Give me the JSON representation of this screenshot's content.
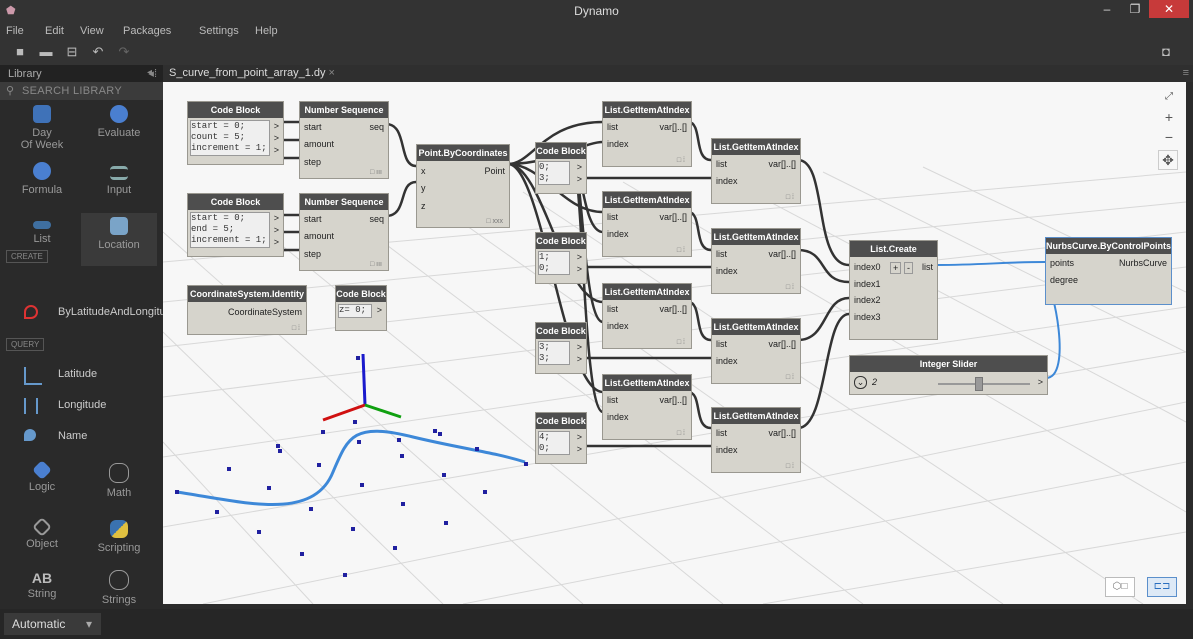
{
  "window": {
    "title": "Dynamo",
    "minimize": "–",
    "maximize": "❐",
    "close": "✕"
  },
  "menu": [
    "File",
    "Edit",
    "View",
    "Packages",
    "Settings",
    "Help"
  ],
  "library": {
    "title": "Library",
    "search_placeholder": "SEARCH LIBRARY",
    "categories_top": [
      {
        "label": "Day\nOf Week",
        "icon": "calendar-icon"
      },
      {
        "label": "Evaluate",
        "icon": "evaluate-icon"
      },
      {
        "label": "Formula",
        "icon": "formula-icon"
      },
      {
        "label": "Input",
        "icon": "input-icon"
      },
      {
        "label": "List",
        "icon": "list-icon"
      },
      {
        "label": "Location",
        "icon": "location-icon"
      }
    ],
    "create_label": "CREATE",
    "create_items": [
      "ByLatitudeAndLongitu"
    ],
    "query_label": "QUERY",
    "query_items": [
      "Latitude",
      "Longitude",
      "Name"
    ],
    "categories_bottom": [
      {
        "label": "Logic",
        "icon": "logic-icon"
      },
      {
        "label": "Math",
        "icon": "math-icon"
      },
      {
        "label": "Object",
        "icon": "object-icon"
      },
      {
        "label": "Scripting",
        "icon": "python-icon"
      },
      {
        "label": "String",
        "icon": "string-icon"
      },
      {
        "label": "Strings",
        "icon": "strings-icon"
      }
    ]
  },
  "tab": {
    "name": "S_curve_from_point_array_1.dy",
    "close": "×"
  },
  "nodes": {
    "code_block_title": "Code Block",
    "code1": "start = 0;\ncount = 5;\nincrement = 1;",
    "code2": "start = 0;\nend = 5;\nincrement = 1;",
    "code3": "z= 0;",
    "code4": "0;\n3;",
    "code5": "1;\n0;",
    "code6": "3;\n3;",
    "code7": "4;\n0;",
    "num_seq_title": "Number Sequence",
    "num_seq_inputs": [
      "start",
      "amount",
      "step"
    ],
    "num_seq_output": "seq",
    "point_title": "Point.ByCoordinates",
    "point_inputs": [
      "x",
      "y",
      "z"
    ],
    "point_output": "Point",
    "cs_title": "CoordinateSystem.Identity",
    "cs_output": "CoordinateSystem",
    "getitem_title": "List.GetItemAtIndex",
    "getitem_inputs": [
      "list",
      "index"
    ],
    "getitem_output": "var[]..[]",
    "list_create_title": "List.Create",
    "list_create_inputs": [
      "index0",
      "index1",
      "index2",
      "index3"
    ],
    "list_create_output": "list",
    "list_create_plus": "+",
    "list_create_minus": "-",
    "slider_title": "Integer Slider",
    "slider_value": "2",
    "slider_value_num": 2,
    "slider_fraction": 0.4,
    "nurbs_title": "NurbsCurve.ByControlPoints",
    "nurbs_inputs": [
      "points",
      "degree"
    ],
    "nurbs_output": "NurbsCurve",
    "arrow": ">",
    "lacing_cs": "□ ⁞",
    "lacing_ns": "□ ııı",
    "lacing_pt": "□ xxx",
    "lacing_gi": "□ ⁞"
  },
  "statusbar": {
    "run_mode": "Automatic",
    "dropdown": "▾"
  }
}
